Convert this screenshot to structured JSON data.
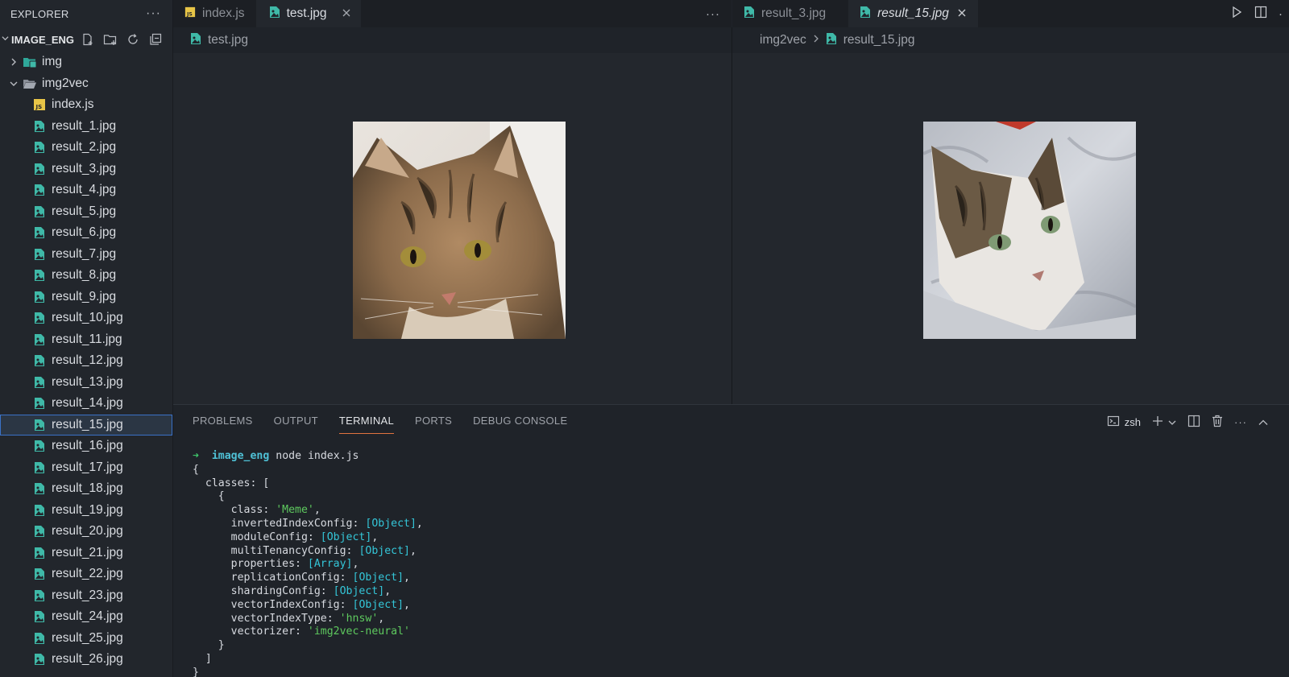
{
  "sidebar": {
    "title": "EXPLORER",
    "more": "···",
    "folder": "IMAGE_ENG",
    "items": [
      {
        "label": "img",
        "type": "folder-closed",
        "level": 1
      },
      {
        "label": "img2vec",
        "type": "folder-open",
        "level": 1
      },
      {
        "label": "index.js",
        "type": "js",
        "level": 2
      },
      {
        "label": "result_1.jpg",
        "type": "image",
        "level": 2
      },
      {
        "label": "result_2.jpg",
        "type": "image",
        "level": 2
      },
      {
        "label": "result_3.jpg",
        "type": "image",
        "level": 2
      },
      {
        "label": "result_4.jpg",
        "type": "image",
        "level": 2
      },
      {
        "label": "result_5.jpg",
        "type": "image",
        "level": 2
      },
      {
        "label": "result_6.jpg",
        "type": "image",
        "level": 2
      },
      {
        "label": "result_7.jpg",
        "type": "image",
        "level": 2
      },
      {
        "label": "result_8.jpg",
        "type": "image",
        "level": 2
      },
      {
        "label": "result_9.jpg",
        "type": "image",
        "level": 2
      },
      {
        "label": "result_10.jpg",
        "type": "image",
        "level": 2
      },
      {
        "label": "result_11.jpg",
        "type": "image",
        "level": 2
      },
      {
        "label": "result_12.jpg",
        "type": "image",
        "level": 2
      },
      {
        "label": "result_13.jpg",
        "type": "image",
        "level": 2
      },
      {
        "label": "result_14.jpg",
        "type": "image",
        "level": 2
      },
      {
        "label": "result_15.jpg",
        "type": "image",
        "level": 2,
        "selected": true
      },
      {
        "label": "result_16.jpg",
        "type": "image",
        "level": 2
      },
      {
        "label": "result_17.jpg",
        "type": "image",
        "level": 2
      },
      {
        "label": "result_18.jpg",
        "type": "image",
        "level": 2
      },
      {
        "label": "result_19.jpg",
        "type": "image",
        "level": 2
      },
      {
        "label": "result_20.jpg",
        "type": "image",
        "level": 2
      },
      {
        "label": "result_21.jpg",
        "type": "image",
        "level": 2
      },
      {
        "label": "result_22.jpg",
        "type": "image",
        "level": 2
      },
      {
        "label": "result_23.jpg",
        "type": "image",
        "level": 2
      },
      {
        "label": "result_24.jpg",
        "type": "image",
        "level": 2
      },
      {
        "label": "result_25.jpg",
        "type": "image",
        "level": 2
      },
      {
        "label": "result_26.jpg",
        "type": "image",
        "level": 2
      }
    ]
  },
  "editor_left": {
    "tabs": [
      {
        "label": "index.js",
        "icon": "js-file-icon",
        "active": false
      },
      {
        "label": "test.jpg",
        "icon": "image-file-icon",
        "active": true
      }
    ],
    "more": "···",
    "breadcrumb": {
      "file": "test.jpg"
    }
  },
  "editor_right": {
    "tabs": [
      {
        "label": "result_3.jpg",
        "icon": "image-file-icon",
        "active": false
      },
      {
        "label": "result_15.jpg",
        "icon": "image-file-icon",
        "active": true,
        "preview": true
      }
    ],
    "breadcrumb": {
      "folder": "img2vec",
      "file": "result_15.jpg"
    }
  },
  "panel": {
    "tabs": [
      "PROBLEMS",
      "OUTPUT",
      "TERMINAL",
      "PORTS",
      "DEBUG CONSOLE"
    ],
    "active_tab": "TERMINAL",
    "shell": "zsh"
  },
  "terminal": {
    "prompt_arrow": "➜",
    "cwd": "image_eng",
    "command": "node index.js",
    "lines": {
      "l1": "{",
      "l2": "  classes: [",
      "l3": "    {",
      "class_key": "      class: ",
      "class_val": "'Meme'",
      "iic_key": "      invertedIndexConfig: ",
      "iic_val": "[Object]",
      "mc_key": "      moduleConfig: ",
      "mc_val": "[Object]",
      "mtc_key": "      multiTenancyConfig: ",
      "mtc_val": "[Object]",
      "props_key": "      properties: ",
      "props_val": "[Array]",
      "rc_key": "      replicationConfig: ",
      "rc_val": "[Object]",
      "sc_key": "      shardingConfig: ",
      "sc_val": "[Object]",
      "vic_key": "      vectorIndexConfig: ",
      "vic_val": "[Object]",
      "vit_key": "      vectorIndexType: ",
      "vit_val": "'hnsw'",
      "vec_key": "      vectorizer: ",
      "vec_val": "'img2vec-neural'",
      "l_close_obj": "    }",
      "l_close_arr": "  ]",
      "l_close": "}"
    }
  },
  "colors": {
    "accent_tab_underline": "#e0733f",
    "selection_outline": "#3a72c7",
    "image_icon": "#3fb9a8",
    "js_icon": "#e8c547"
  }
}
